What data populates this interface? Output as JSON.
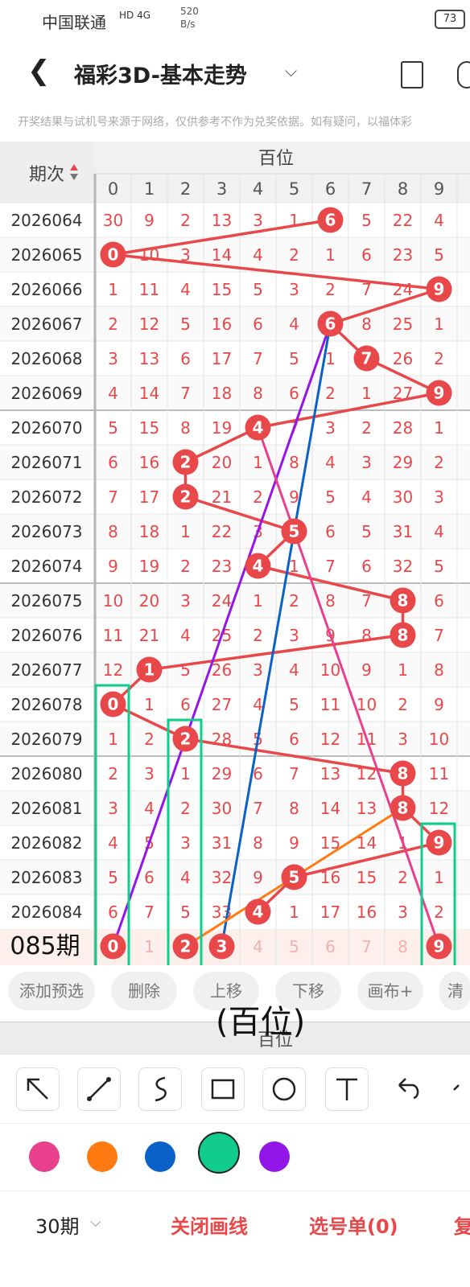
{
  "status": {
    "carrier": "中国联通",
    "net": "HD 4G",
    "speed": "520\nB/s",
    "battery": "73"
  },
  "header": {
    "title": "福彩3D-基本走势"
  },
  "notice": "开奖结果与试机号来源于网络，仅供参考不作为兑奖依据。如有疑问，以福体彩",
  "table": {
    "col_period": "期次",
    "group_label": "百位",
    "digits": [
      "0",
      "1",
      "2",
      "3",
      "4",
      "5",
      "6",
      "7",
      "8",
      "9"
    ],
    "rows": [
      {
        "period": "2026064",
        "cells": [
          "30",
          "9",
          "2",
          "13",
          "3",
          "1",
          "6",
          "5",
          "22",
          "4"
        ],
        "hit": 6
      },
      {
        "period": "2026065",
        "cells": [
          "0",
          "10",
          "3",
          "14",
          "4",
          "2",
          "1",
          "6",
          "23",
          "5"
        ],
        "hit": 0
      },
      {
        "period": "2026066",
        "cells": [
          "1",
          "11",
          "4",
          "15",
          "5",
          "3",
          "2",
          "7",
          "24",
          "9"
        ],
        "hit": 9
      },
      {
        "period": "2026067",
        "cells": [
          "2",
          "12",
          "5",
          "16",
          "6",
          "4",
          "6",
          "8",
          "25",
          "1"
        ],
        "hit": 6
      },
      {
        "period": "2026068",
        "cells": [
          "3",
          "13",
          "6",
          "17",
          "7",
          "5",
          "1",
          "7",
          "26",
          "2"
        ],
        "hit": 7
      },
      {
        "period": "2026069",
        "cells": [
          "4",
          "14",
          "7",
          "18",
          "8",
          "6",
          "2",
          "1",
          "27",
          "9"
        ],
        "hit": 9
      },
      {
        "period": "2026070",
        "cells": [
          "5",
          "15",
          "8",
          "19",
          "4",
          "7",
          "3",
          "2",
          "28",
          "1"
        ],
        "hit": 4
      },
      {
        "period": "2026071",
        "cells": [
          "6",
          "16",
          "2",
          "20",
          "1",
          "8",
          "4",
          "3",
          "29",
          "2"
        ],
        "hit": 2
      },
      {
        "period": "2026072",
        "cells": [
          "7",
          "17",
          "2",
          "21",
          "2",
          "9",
          "5",
          "4",
          "30",
          "3"
        ],
        "hit": 2
      },
      {
        "period": "2026073",
        "cells": [
          "8",
          "18",
          "1",
          "22",
          "3",
          "5",
          "6",
          "5",
          "31",
          "4"
        ],
        "hit": 5
      },
      {
        "period": "2026074",
        "cells": [
          "9",
          "19",
          "2",
          "23",
          "4",
          "1",
          "7",
          "6",
          "32",
          "5"
        ],
        "hit": 4
      },
      {
        "period": "2026075",
        "cells": [
          "10",
          "20",
          "3",
          "24",
          "1",
          "2",
          "8",
          "7",
          "8",
          "6"
        ],
        "hit": 8
      },
      {
        "period": "2026076",
        "cells": [
          "11",
          "21",
          "4",
          "25",
          "2",
          "3",
          "9",
          "8",
          "8",
          "7"
        ],
        "hit": 8
      },
      {
        "period": "2026077",
        "cells": [
          "12",
          "1",
          "5",
          "26",
          "3",
          "4",
          "10",
          "9",
          "1",
          "8"
        ],
        "hit": 1
      },
      {
        "period": "2026078",
        "cells": [
          "0",
          "1",
          "6",
          "27",
          "4",
          "5",
          "11",
          "10",
          "2",
          "9"
        ],
        "hit": 0
      },
      {
        "period": "2026079",
        "cells": [
          "1",
          "2",
          "2",
          "28",
          "5",
          "6",
          "12",
          "11",
          "3",
          "10"
        ],
        "hit": 2
      },
      {
        "period": "2026080",
        "cells": [
          "2",
          "3",
          "1",
          "29",
          "6",
          "7",
          "13",
          "12",
          "8",
          "11"
        ],
        "hit": 8
      },
      {
        "period": "2026081",
        "cells": [
          "3",
          "4",
          "2",
          "30",
          "7",
          "8",
          "14",
          "13",
          "8",
          "12"
        ],
        "hit": 8
      },
      {
        "period": "2026082",
        "cells": [
          "4",
          "5",
          "3",
          "31",
          "8",
          "9",
          "15",
          "14",
          "1",
          "9"
        ],
        "hit": 9
      },
      {
        "period": "2026083",
        "cells": [
          "5",
          "6",
          "4",
          "32",
          "9",
          "5",
          "16",
          "15",
          "2",
          "1"
        ],
        "hit": 5
      },
      {
        "period": "2026084",
        "cells": [
          "6",
          "7",
          "5",
          "33",
          "4",
          "1",
          "17",
          "16",
          "3",
          "2"
        ],
        "hit": 4
      }
    ],
    "predict_label": "085期",
    "predict_cells": [
      "0",
      "1",
      "2",
      "3",
      "4",
      "5",
      "6",
      "7",
      "8",
      "9"
    ]
  },
  "toolbar": {
    "add": "添加预选",
    "delete": "删除",
    "up": "上移",
    "down": "下移",
    "canvas": "画布+",
    "more": "清"
  },
  "annotation_text": "(百位)",
  "colors": {
    "pink": "#e8408c",
    "orange": "#ff7a10",
    "blue": "#0a62c8",
    "green": "#12cc8e",
    "purple": "#9216e8",
    "red": "#e8484a"
  },
  "footer": {
    "periods": "30期",
    "close": "关闭画线",
    "selection": "选号单(0)",
    "extra": "复"
  }
}
